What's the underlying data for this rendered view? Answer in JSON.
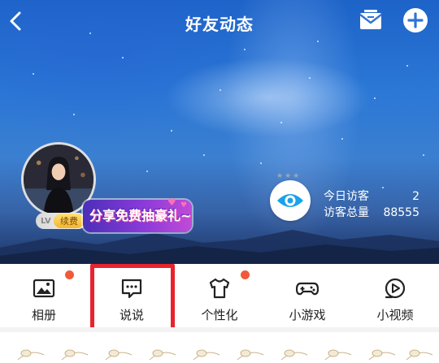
{
  "header": {
    "title": "好友动态"
  },
  "profile": {
    "level_text": "LV",
    "renew_label": "续费",
    "promo_text": "分享免费抽豪礼~"
  },
  "visitors": {
    "today_label": "今日访客",
    "today_count": "2",
    "total_label": "访客总量",
    "total_count": "88555"
  },
  "nav": {
    "items": [
      {
        "label": "相册",
        "icon": "photo-album-icon",
        "badge": true
      },
      {
        "label": "说说",
        "icon": "chat-bubble-icon",
        "badge": false
      },
      {
        "label": "个性化",
        "icon": "tshirt-icon",
        "badge": true
      },
      {
        "label": "小游戏",
        "icon": "gamepad-icon",
        "badge": false
      },
      {
        "label": "小视频",
        "icon": "play-video-icon",
        "badge": false
      }
    ]
  },
  "colors": {
    "highlight": "#e8232e",
    "badge": "#f05a3a",
    "eye_accent": "#1aa2ea"
  }
}
